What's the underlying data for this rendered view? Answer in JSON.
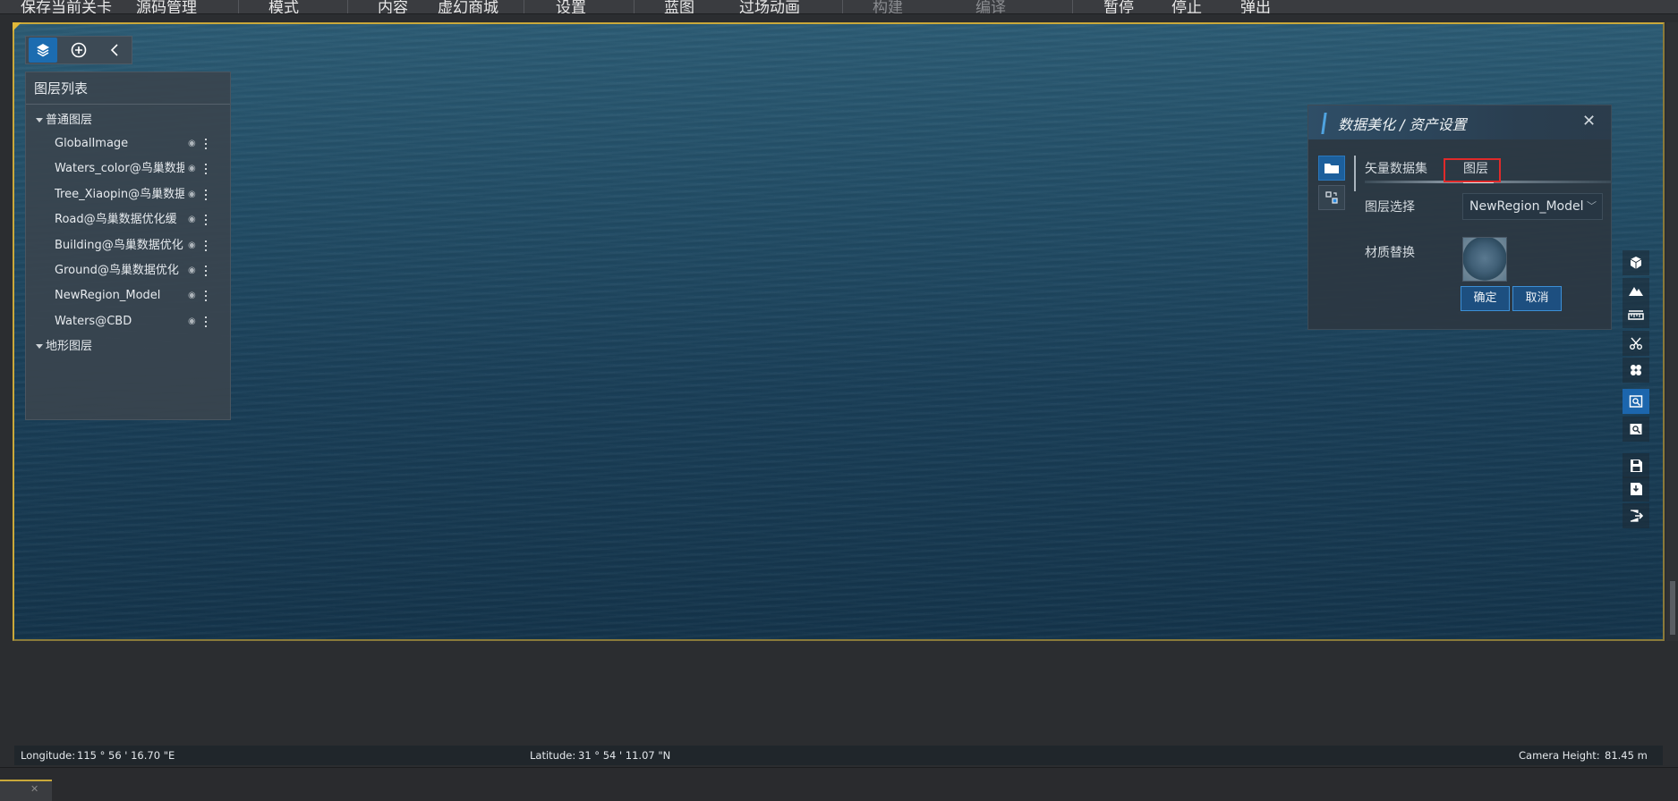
{
  "menubar": {
    "items": [
      {
        "label": "保存当前关卡",
        "disabled": false
      },
      {
        "label": "源码管理",
        "disabled": false
      },
      {
        "label": "模式",
        "disabled": false
      },
      {
        "label": "内容",
        "disabled": false
      },
      {
        "label": "虚幻商城",
        "disabled": false
      },
      {
        "label": "设置",
        "disabled": false
      },
      {
        "label": "蓝图",
        "disabled": false
      },
      {
        "label": "过场动画",
        "disabled": false
      },
      {
        "label": "构建",
        "disabled": true
      },
      {
        "label": "编译",
        "disabled": true
      },
      {
        "label": "暂停",
        "disabled": false
      },
      {
        "label": "停止",
        "disabled": false
      },
      {
        "label": "弹出",
        "disabled": false
      }
    ]
  },
  "layer_toolbar": {
    "buttons": [
      "layers-icon",
      "add-circle-icon",
      "collapse-left-icon"
    ]
  },
  "layer_panel": {
    "title": "图层列表",
    "groups": [
      {
        "label": "普通图层",
        "layers": [
          "GlobalImage",
          "Waters_color@鸟巢数据",
          "Tree_Xiaopin@鸟巢数据",
          "Road@鸟巢数据优化缓",
          "Building@鸟巢数据优化",
          "Ground@鸟巢数据优化",
          "NewRegion_Model",
          "Waters@CBD"
        ]
      },
      {
        "label": "地形图层",
        "layers": []
      }
    ]
  },
  "dialog": {
    "title": "数据美化 / 资产设置",
    "tabs": {
      "vector_dataset": "矢量数据集",
      "layer": "图层"
    },
    "active_tab": "图层",
    "layer_select_label": "图层选择",
    "layer_select_value": "NewRegion_Model",
    "material_label": "材质替换",
    "ok_label": "确定",
    "cancel_label": "取消"
  },
  "status": {
    "longitude_label": "Longitude:",
    "longitude_value": "115 ° 56 ' 16.70 \"E",
    "latitude_label": "Latitude:",
    "latitude_value": "31 ° 54 ' 11.07 \"N",
    "camera_label": "Camera Height:",
    "camera_value": "81.45 m"
  },
  "colors": {
    "accent": "#1c6cb0",
    "highlight": "#e02a2a",
    "viewport_border": "#c9a83a"
  }
}
